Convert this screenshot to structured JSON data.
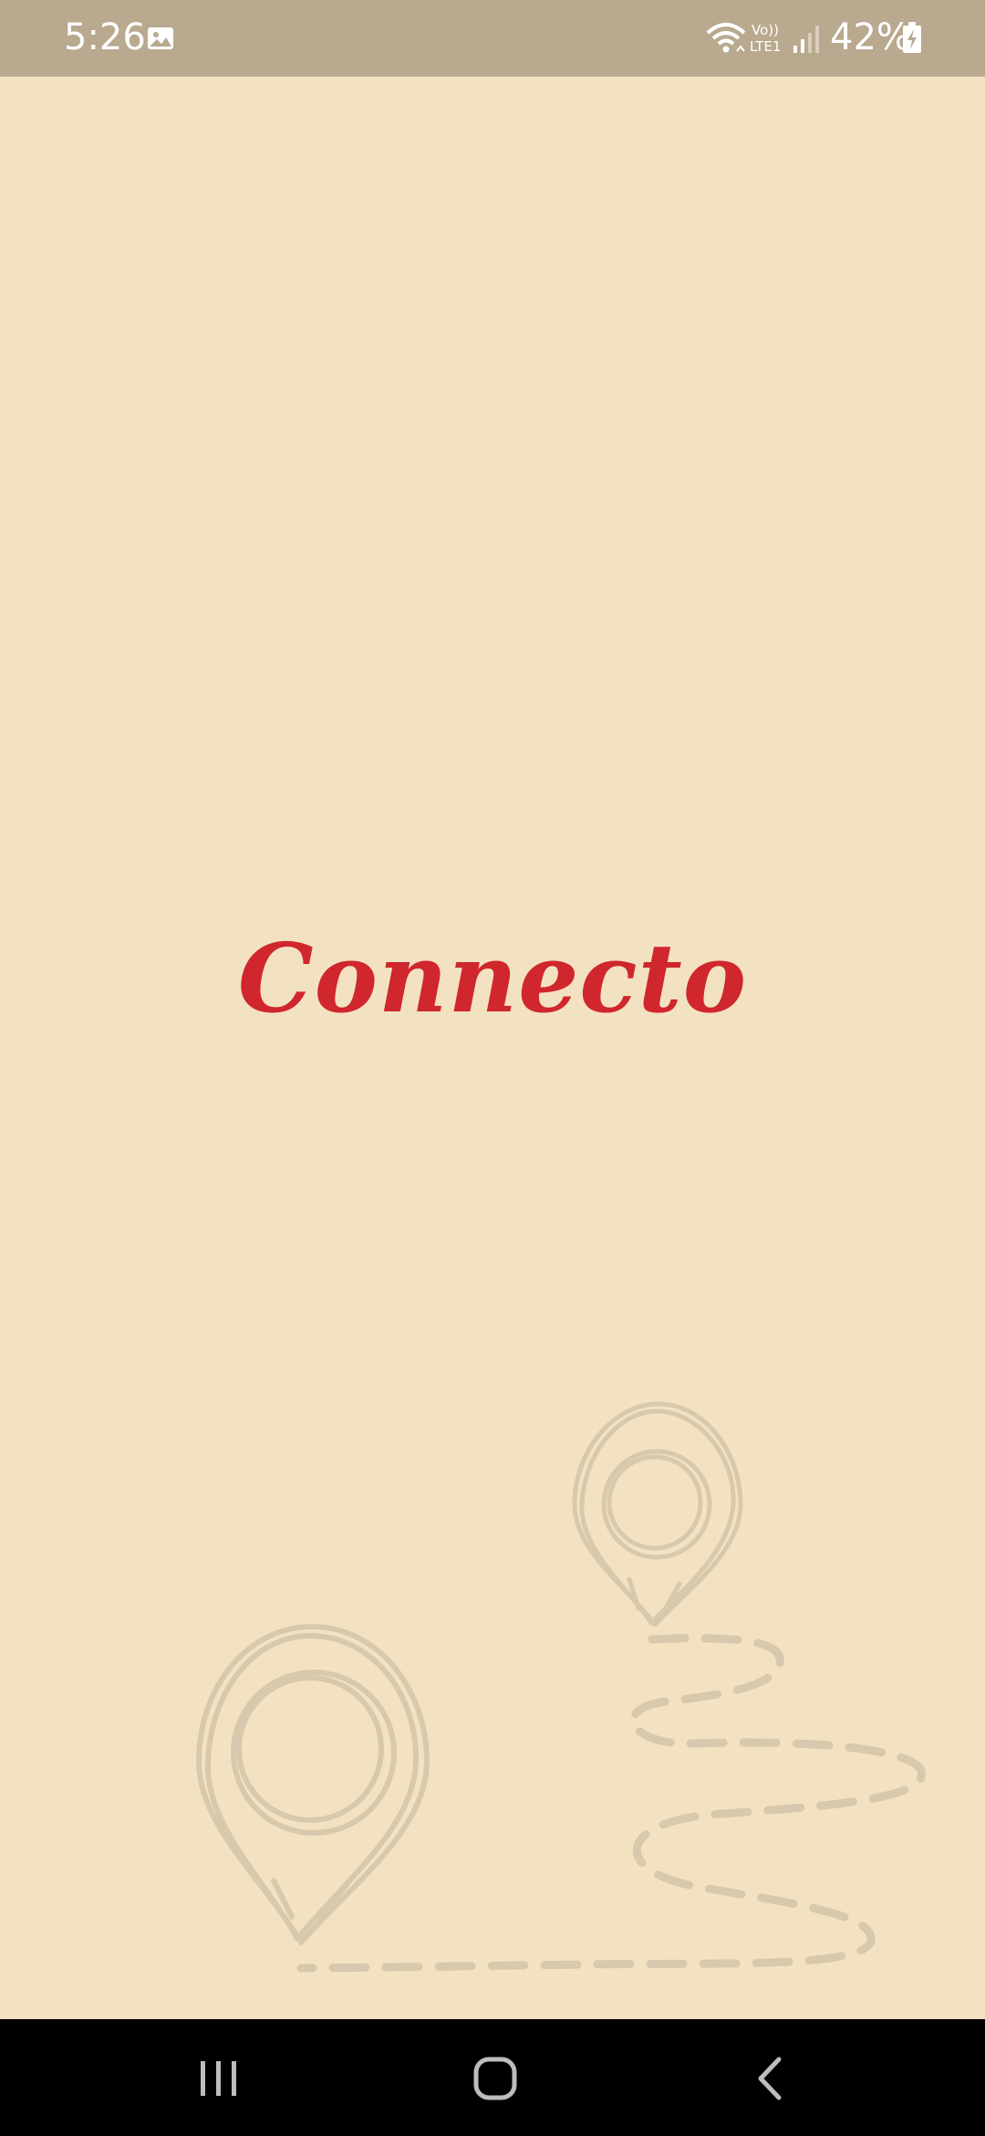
{
  "status_bar": {
    "time": "5:26",
    "network_label": "Vo))\nLTE1",
    "battery": "42%",
    "background_color": "#b8a98f"
  },
  "app": {
    "name": "Connecto",
    "brand_color": "#d0262d",
    "background_color": "#f3e2c2"
  },
  "icons": {
    "gallery": "image-icon",
    "wifi": "wifi-icon",
    "signal": "signal-icon",
    "battery": "battery-charging-icon",
    "recents": "recents-icon",
    "home": "home-icon",
    "back": "back-icon",
    "decoration": "map-pins-route-illustration"
  }
}
